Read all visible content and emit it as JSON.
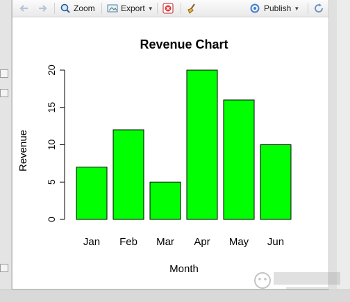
{
  "toolbar": {
    "zoom_label": "Zoom",
    "export_label": "Export",
    "publish_label": "Publish"
  },
  "colors": {
    "bar_fill": "#00ff00",
    "bar_stroke": "#000000"
  },
  "chart_data": {
    "type": "bar",
    "title": "Revenue Chart",
    "xlabel": "Month",
    "ylabel": "Revenue",
    "categories": [
      "Jan",
      "Feb",
      "Mar",
      "Apr",
      "May",
      "Jun"
    ],
    "values": [
      7,
      12,
      5,
      20,
      16,
      10
    ],
    "ylim": [
      0,
      20
    ],
    "yticks": [
      "0",
      "5",
      "10",
      "15",
      "20"
    ],
    "grid": false,
    "legend": "none"
  }
}
